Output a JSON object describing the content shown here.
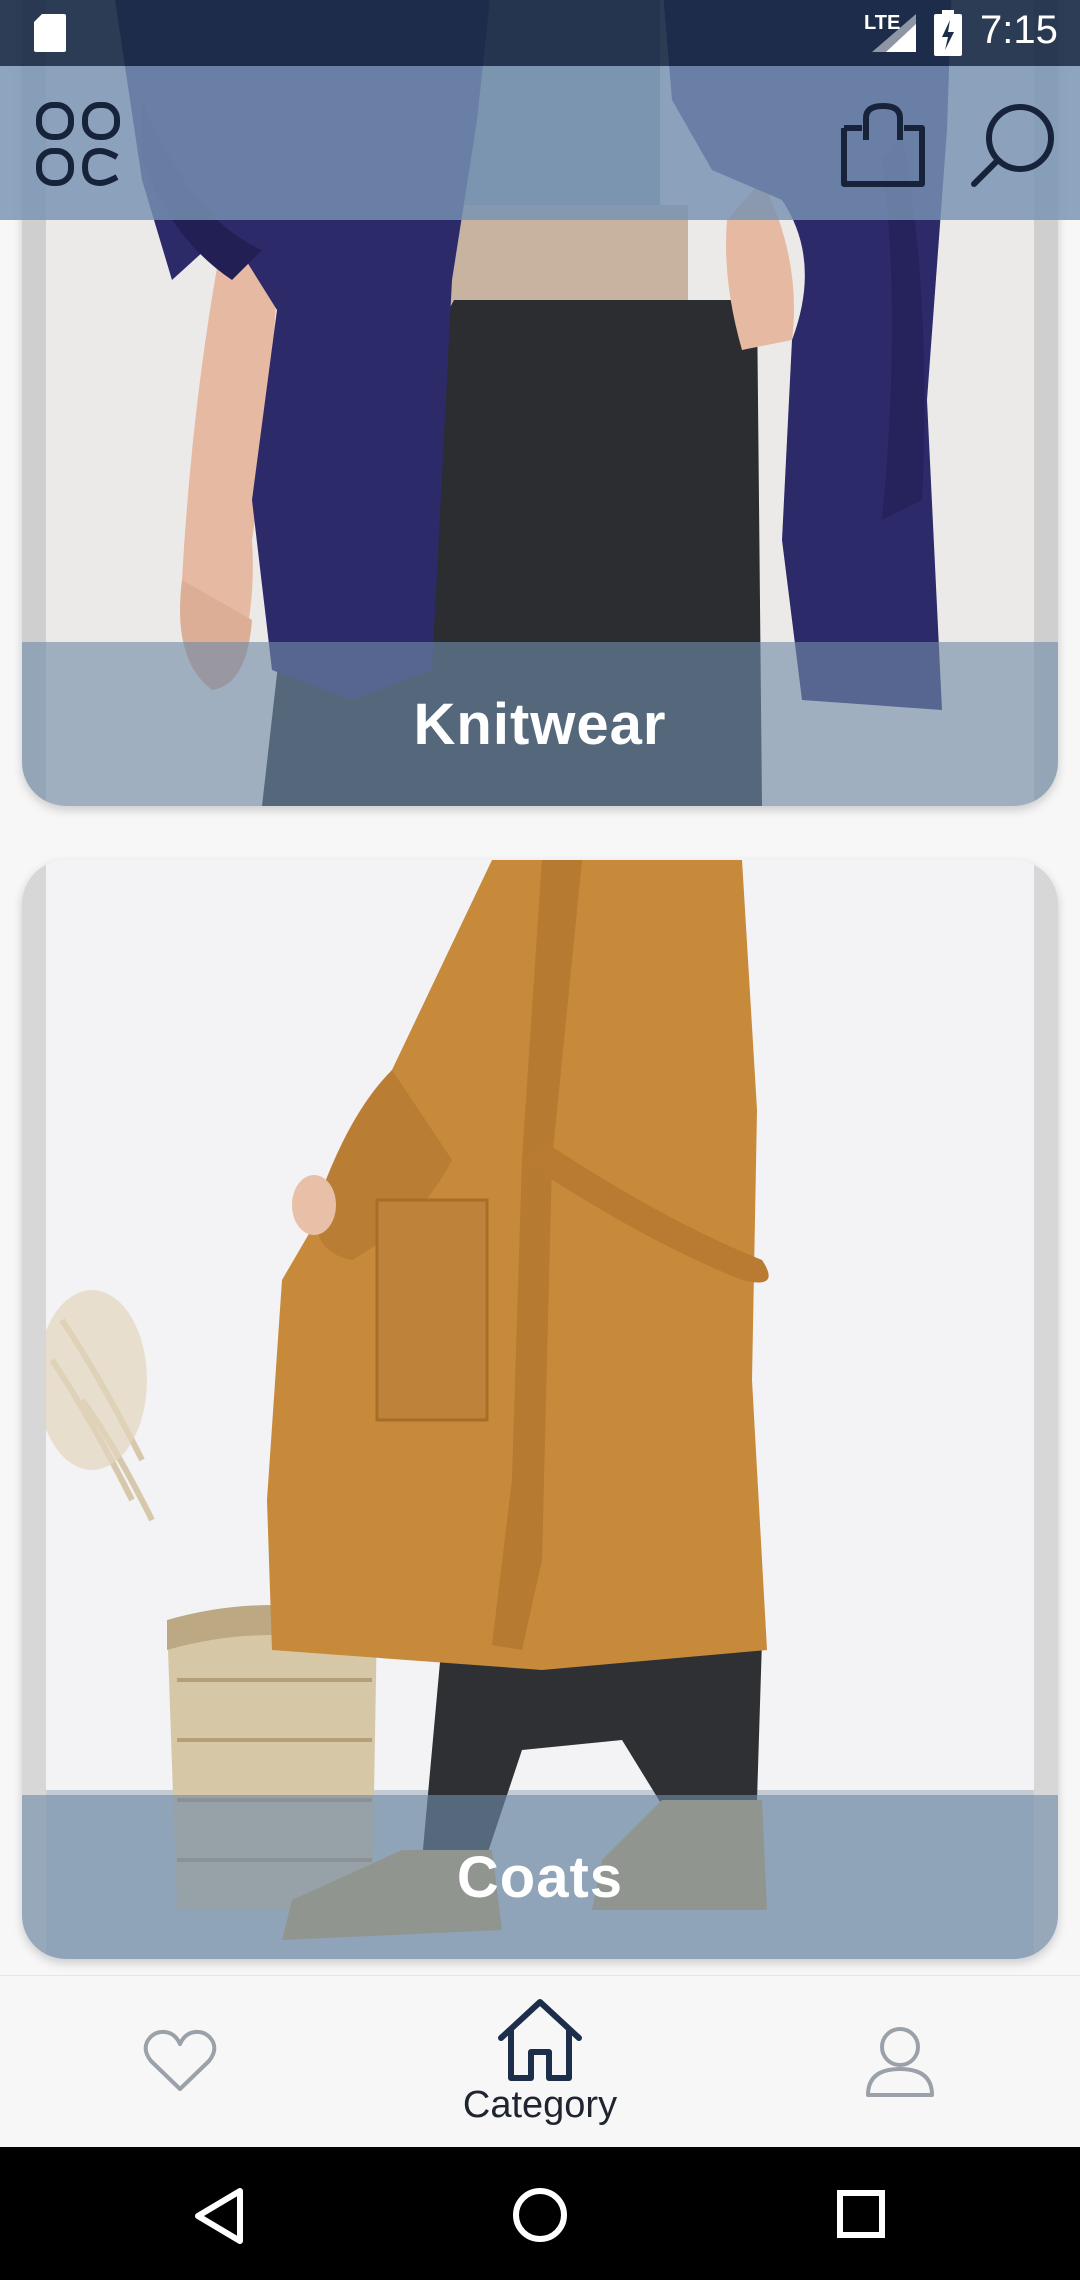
{
  "status_bar": {
    "time": "7:15",
    "network": "LTE",
    "icons": [
      "sd-card-icon",
      "signal-icon",
      "battery-charging-icon"
    ]
  },
  "app_bar": {
    "left_icon": "grid-menu-icon",
    "right_icons": [
      "shopping-bag-icon",
      "search-icon"
    ]
  },
  "categories": [
    {
      "label": "Knitwear",
      "image": "model in navy coat, grey sweater and dark trousers"
    },
    {
      "label": "Coats",
      "image": "model in camel wool coat beside a woven basket"
    }
  ],
  "bottom_nav": {
    "items": [
      {
        "icon": "heart-icon",
        "label": ""
      },
      {
        "icon": "home-icon",
        "label": "Category",
        "active": true
      },
      {
        "icon": "user-icon",
        "label": ""
      }
    ]
  },
  "system_nav": {
    "icons": [
      "back-icon",
      "home-circle-icon",
      "recents-icon"
    ]
  },
  "colors": {
    "accent": "#1c2e4a",
    "caption_overlay": "#708aa8",
    "app_bar": "#7692b2",
    "status_bar": "#1c2d48"
  }
}
